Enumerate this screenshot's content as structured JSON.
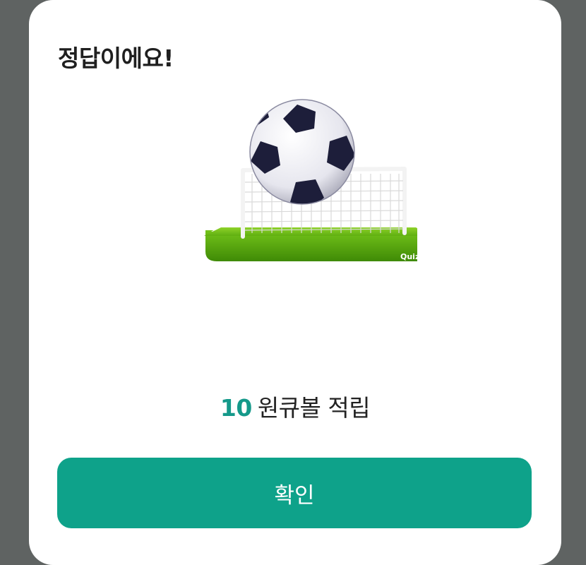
{
  "dialog": {
    "title": "정답이에요!",
    "badge_text": "Quiz",
    "reward": {
      "amount": "10",
      "unit_text": "원큐볼 적립"
    },
    "confirm_label": "확인"
  },
  "icons": {
    "illustration": "soccer-ball-goal-icon"
  },
  "colors": {
    "accent": "#15998a",
    "button": "#0ea28a",
    "backdrop": "#5f6362",
    "field": "#7bc420"
  }
}
